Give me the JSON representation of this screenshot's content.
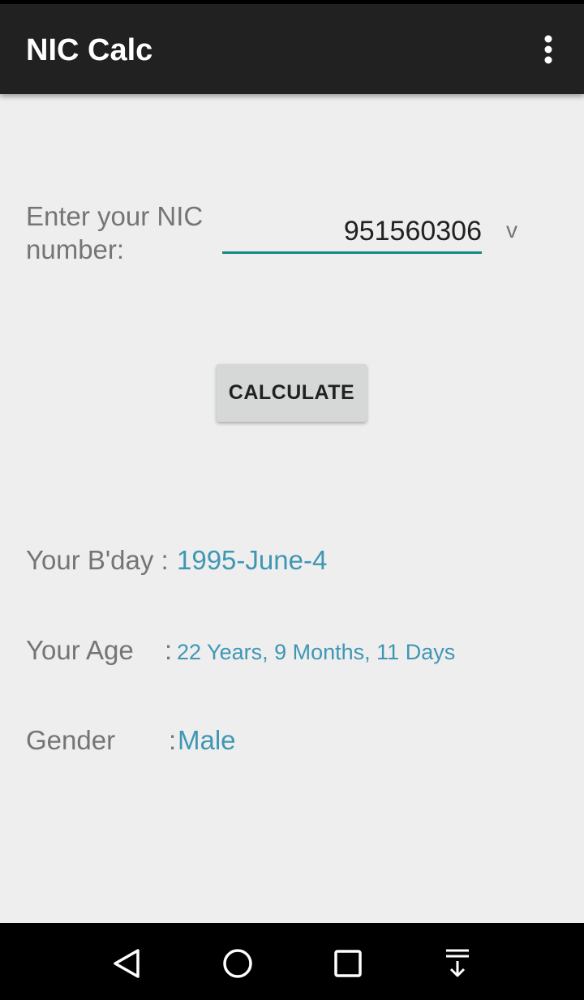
{
  "app_bar": {
    "title": "NIC Calc",
    "overflow_icon": "more-vert-icon"
  },
  "form": {
    "nic_label": "Enter your NIC number:",
    "nic_value": "951560306",
    "nic_suffix": "v"
  },
  "calculate_button": {
    "label": "CALCULATE"
  },
  "results": {
    "bday": {
      "label": "Your B'day :",
      "value": "1995-June-4"
    },
    "age": {
      "label": "Your Age",
      "colon": ":",
      "value": "22 Years, 9 Months, 11 Days"
    },
    "gender": {
      "label": "Gender",
      "colon": ":",
      "value": "Male"
    }
  },
  "nav_bar": {
    "back_icon": "back-triangle-icon",
    "home_icon": "home-circle-icon",
    "recents_icon": "recents-square-icon",
    "notifications_icon": "pull-down-notifications-icon"
  },
  "colors": {
    "app_bar": "#212121",
    "accent": "#138a83",
    "result_value": "#3f97b4",
    "background": "#eeeeee"
  }
}
